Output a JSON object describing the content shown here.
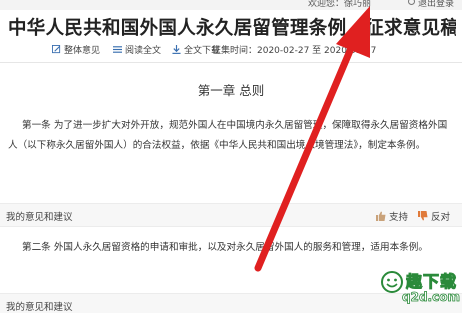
{
  "header": {
    "user_text": "欢迎您：徐巧丽",
    "logout_label": "退出登录"
  },
  "page_title": "中华人民共和国外国人永久居留管理条例（征求意见稿）",
  "meta": {
    "overall_opinion_label": "整体意见",
    "read_full_label": "阅读全文",
    "download_label": "全文下载",
    "period_text": "征集时间：2020-02-27 至 2020-03-27"
  },
  "chapter_title": "第一章 总则",
  "articles": [
    {
      "text": "第一条 为了进一步扩大对外开放，规范外国人在中国境内永久居留管理，保障取得永久居留资格外国人（以下称永久居留外国人）的合法权益，依据《中华人民共和国出境入境管理法》，制定本条例。"
    },
    {
      "text": "第二条 外国人永久居留资格的申请和审批，以及对永久居留外国人的服务和管理，适用本条例。"
    }
  ],
  "opinion_bar": {
    "label": "我的意见和建议",
    "support_label": "支持",
    "oppose_label": "反对"
  },
  "watermark": {
    "main": "趣下载",
    "sub": "q2d.com"
  },
  "colors": {
    "arrow": "#e02020",
    "thumb_up": "#c9a27a",
    "thumb_down": "#e07a3a",
    "watermark_green": "#2a8a3a"
  }
}
